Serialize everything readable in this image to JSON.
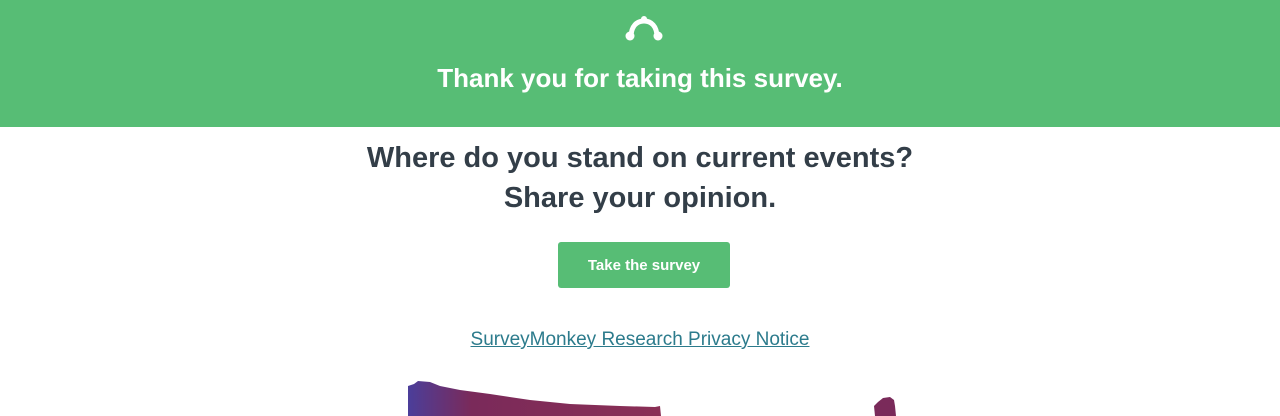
{
  "banner": {
    "logo_icon": "surveymonkey-logo-icon",
    "title": "Thank you for taking this survey."
  },
  "promo": {
    "headline_line1": "Where do you stand on current events?",
    "headline_line2": "Share your opinion.",
    "cta_label": "Take the survey"
  },
  "footer": {
    "privacy_link": "SurveyMonkey Research Privacy Notice"
  },
  "colors": {
    "brand_green": "#57bd75",
    "heading_text": "#333e48",
    "link": "#2c7b8c",
    "map_purple": "#7a2a5a",
    "map_blue": "#4b3e9a"
  },
  "map": {
    "icon": "us-map-graphic"
  }
}
